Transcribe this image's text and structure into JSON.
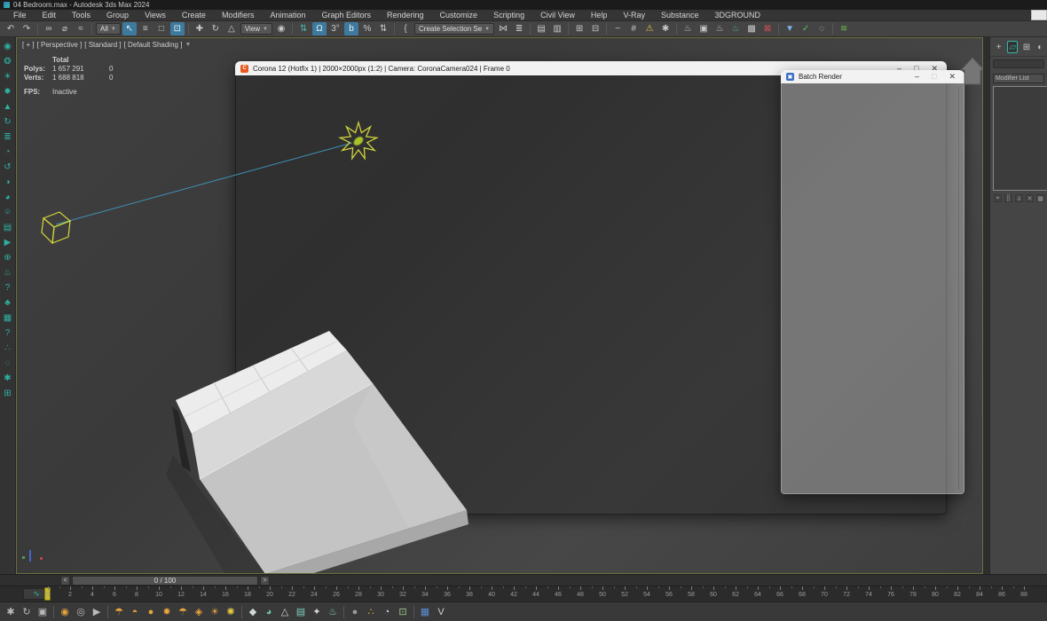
{
  "window": {
    "title": "04 Bedroom.max - Autodesk 3ds Max 2024"
  },
  "menu": {
    "items": [
      "File",
      "Edit",
      "Tools",
      "Group",
      "Views",
      "Create",
      "Modifiers",
      "Animation",
      "Graph Editors",
      "Rendering",
      "Customize",
      "Scripting",
      "Civil View",
      "Help",
      "V-Ray",
      "Substance",
      "3DGROUND"
    ]
  },
  "toolbar": {
    "items": [
      {
        "n": "undo-icon",
        "g": "↶"
      },
      {
        "n": "redo-icon",
        "g": "↷"
      },
      {
        "t": "div"
      },
      {
        "n": "link-icon",
        "g": "∞"
      },
      {
        "n": "unlink-icon",
        "g": "⌀"
      },
      {
        "n": "bind-spacewarp-icon",
        "g": "≈"
      },
      {
        "t": "div"
      },
      {
        "t": "dd",
        "n": "selection-filter-dropdown",
        "l": "All"
      },
      {
        "n": "select-object-icon",
        "g": "↖",
        "a": true
      },
      {
        "n": "select-by-name-icon",
        "g": "≡"
      },
      {
        "n": "selection-region-icon",
        "g": "□"
      },
      {
        "n": "window-crossing-icon",
        "g": "⊡",
        "a": true
      },
      {
        "t": "div"
      },
      {
        "n": "move-icon",
        "g": "✚"
      },
      {
        "n": "rotate-icon",
        "g": "↻"
      },
      {
        "n": "scale-icon",
        "g": "△"
      },
      {
        "t": "dd",
        "n": "reference-coordinate-dropdown",
        "l": "View"
      },
      {
        "n": "use-pivot-icon",
        "g": "◉"
      },
      {
        "t": "div"
      },
      {
        "n": "select-similar-icon",
        "g": "⇅",
        "c": "#49b6a6"
      },
      {
        "n": "snap-toggle-icon",
        "g": "Ω",
        "a": true
      },
      {
        "n": "angle-snap-icon",
        "g": "3°"
      },
      {
        "n": "snap-variant-icon",
        "g": "b",
        "a": true
      },
      {
        "n": "percent-snap-icon",
        "g": "%"
      },
      {
        "n": "spinner-snap-icon",
        "g": "⇅"
      },
      {
        "t": "div"
      },
      {
        "n": "named-selection-sets-icon",
        "g": "{"
      },
      {
        "t": "dd",
        "n": "selection-set-dropdown",
        "l": "Create Selection Se"
      },
      {
        "n": "mirror-icon",
        "g": "⋈"
      },
      {
        "n": "align-icon",
        "g": "≣"
      },
      {
        "t": "div"
      },
      {
        "n": "layer-explorer-icon",
        "g": "▤"
      },
      {
        "n": "toggle-ribbon-icon",
        "g": "▥"
      },
      {
        "t": "div"
      },
      {
        "n": "scene-explorer-icon",
        "g": "⊞"
      },
      {
        "n": "material-explorer-icon",
        "g": "⊟"
      },
      {
        "t": "div"
      },
      {
        "n": "curve-editor-icon",
        "g": "~"
      },
      {
        "n": "schematic-view-icon",
        "g": "#"
      },
      {
        "n": "warning-icon",
        "g": "⚠",
        "c": "#e8c23d"
      },
      {
        "n": "asset-tracking-icon",
        "g": "✱"
      },
      {
        "t": "div"
      },
      {
        "n": "render-setup-icon",
        "g": "♨"
      },
      {
        "n": "rendered-frame-icon",
        "g": "▣"
      },
      {
        "n": "render-production-icon",
        "g": "♨"
      },
      {
        "n": "render-iterative-icon",
        "g": "♨",
        "c": "#49b6a6"
      },
      {
        "n": "render-texture-icon",
        "g": "▩"
      },
      {
        "n": "render-abort-icon",
        "g": "⊠",
        "c": "#d05050"
      },
      {
        "t": "div"
      },
      {
        "n": "save-state-icon",
        "g": "▼",
        "c": "#7fb2e8"
      },
      {
        "n": "check-icon",
        "g": "✓",
        "c": "#5fc060"
      },
      {
        "n": "info-icon",
        "g": "◌"
      },
      {
        "t": "div"
      },
      {
        "n": "corona-toolbar-icon",
        "g": "≋",
        "c": "#6cc04a"
      }
    ]
  },
  "left_toolbar": {
    "items": [
      {
        "n": "camera-icon",
        "g": "◉"
      },
      {
        "n": "camera-settings-icon",
        "g": "❂"
      },
      {
        "n": "light-icon",
        "g": "☀"
      },
      {
        "n": "sun-icon",
        "g": "✹"
      },
      {
        "n": "vegetation-icon",
        "g": "▲"
      },
      {
        "n": "update-icon",
        "g": "↻"
      },
      {
        "n": "list-icon",
        "g": "≣"
      },
      {
        "n": "bell-icon",
        "g": "◔"
      },
      {
        "n": "reset-icon",
        "g": "↺"
      },
      {
        "n": "paint-icon",
        "g": "◑"
      },
      {
        "n": "mask-icon",
        "g": "◕"
      },
      {
        "n": "lamp-icon",
        "g": "⌾"
      },
      {
        "n": "layers-icon",
        "g": "▤"
      },
      {
        "n": "play-icon",
        "g": "▶"
      },
      {
        "n": "target-icon",
        "g": "⊕"
      },
      {
        "n": "teapot-icon",
        "g": "♨"
      },
      {
        "n": "help-icon",
        "g": "?"
      },
      {
        "n": "forest-warning-icon",
        "g": "♣"
      },
      {
        "n": "notes-icon",
        "g": "▦"
      },
      {
        "n": "about-icon",
        "g": "?"
      },
      {
        "n": "scatter-icon",
        "g": "∴"
      },
      {
        "n": "select-circle-icon",
        "g": "◌"
      },
      {
        "n": "particles-icon",
        "g": "✱"
      },
      {
        "n": "grid-array-icon",
        "g": "⊞"
      }
    ]
  },
  "viewport": {
    "label": {
      "plus": "[ + ]",
      "view": "[ Perspective ]",
      "style": "[ Standard ]",
      "shading": "[ Default Shading ]"
    },
    "stats": {
      "total_label": "Total",
      "polys_label": "Polys:",
      "polys_value": "1 657 291",
      "polys_second": "0",
      "verts_label": "Verts:",
      "verts_value": "1 688 818",
      "verts_second": "0",
      "fps_label": "FPS:",
      "fps_value": "Inactive"
    }
  },
  "vfb": {
    "title": "Corona 12 (Hotfix 1) | 2000×2000px (1:2) | Camera: CoronaCamera024 | Frame 0",
    "minimize": "–",
    "maximize": "□",
    "close": "✕"
  },
  "batch": {
    "title": "Batch Render",
    "minimize": "–",
    "maximize": "□",
    "close": "✕"
  },
  "command_panel": {
    "tabs": [
      {
        "n": "create-tab",
        "g": "+"
      },
      {
        "n": "modify-tab",
        "g": "▱",
        "a": true
      },
      {
        "n": "hierarchy-tab",
        "g": "⊞"
      },
      {
        "n": "motion-tab",
        "g": "◐"
      }
    ],
    "modifier_list_label": "Modifier List",
    "stack_buttons": [
      {
        "n": "pin-stack-icon",
        "g": "⌖"
      },
      {
        "n": "show-end-result-icon",
        "g": "║"
      },
      {
        "n": "make-unique-icon",
        "g": "⇓"
      },
      {
        "n": "remove-modifier-icon",
        "g": "✕"
      },
      {
        "n": "configure-modifier-icon",
        "g": "▦"
      }
    ]
  },
  "timeline": {
    "current": "0 / 100",
    "prev": "<",
    "next": ">",
    "labels": [
      0,
      2,
      4,
      6,
      8,
      10,
      12,
      14,
      16,
      18,
      20,
      22,
      24,
      26,
      28,
      30,
      32,
      34,
      36,
      38,
      40,
      42,
      44,
      46,
      48,
      50,
      52,
      54,
      56,
      58,
      60,
      62,
      64,
      66,
      68,
      70,
      72,
      74,
      76,
      78,
      80,
      82,
      84,
      86,
      88
    ],
    "frames_end": 88
  },
  "bottom_toolbar": {
    "items": [
      {
        "n": "pan-hand-icon",
        "g": "✱",
        "c": "#b9b9b9"
      },
      {
        "n": "orbit-icon",
        "g": "↻",
        "c": "#b9b9b9"
      },
      {
        "n": "camera-frame-icon",
        "g": "▣",
        "c": "#b9b9b9"
      },
      {
        "t": "div"
      },
      {
        "n": "light-bulb-icon",
        "g": "◉",
        "c": "#e8a33d"
      },
      {
        "n": "camera-icon",
        "g": "◎",
        "c": "#b9b9b9"
      },
      {
        "n": "video-camera-icon",
        "g": "▶",
        "c": "#b9b9b9"
      },
      {
        "t": "div"
      },
      {
        "n": "corona-light-icon",
        "g": "☂",
        "c": "#e8a33d"
      },
      {
        "n": "dome-light-icon",
        "g": "◓",
        "c": "#e8a33d"
      },
      {
        "n": "sphere-light-icon",
        "g": "●",
        "c": "#e8a33d"
      },
      {
        "n": "gear-icon",
        "g": "✸",
        "c": "#e8a33d"
      },
      {
        "n": "sky-light-icon",
        "g": "☂",
        "c": "#e8a33d"
      },
      {
        "n": "caustics-icon",
        "g": "◈",
        "c": "#e8a33d"
      },
      {
        "n": "sun-light-icon",
        "g": "☀",
        "c": "#e8a33d"
      },
      {
        "n": "sunburst-icon",
        "g": "✺",
        "c": "#e5c93f"
      },
      {
        "t": "div"
      },
      {
        "n": "polyhedron-icon",
        "g": "◆",
        "c": "#cfd8d8"
      },
      {
        "n": "scatter-sphere-icon",
        "g": "◕",
        "c": "#69c0a8"
      },
      {
        "n": "proxy-pyramid-icon",
        "g": "△",
        "c": "#cfd8d8"
      },
      {
        "n": "slicer-icon",
        "g": "▤",
        "c": "#7fd0c0"
      },
      {
        "n": "interactive-hand-icon",
        "g": "✦",
        "c": "#cfd8d8"
      },
      {
        "n": "fire-icon",
        "g": "♨",
        "c": "#7fd0c0"
      },
      {
        "t": "div"
      },
      {
        "n": "material-sphere-icon",
        "g": "●",
        "c": "#9a9a9a"
      },
      {
        "n": "particle-dots-icon",
        "g": "∴",
        "c": "#e8a33d"
      },
      {
        "n": "mask-icon",
        "g": "◔",
        "c": "#cfcfcf"
      },
      {
        "n": "display-icon",
        "g": "⊡",
        "c": "#9fd08f"
      },
      {
        "t": "div"
      },
      {
        "n": "swatches-icon",
        "g": "▦",
        "c": "#5b8fd4"
      },
      {
        "n": "vray-logo-icon",
        "g": "V",
        "c": "#cfcfcf"
      }
    ]
  },
  "colors": {
    "accent_teal": "#2fb0a0",
    "highlight_blue": "#3d7a9e",
    "gizmo_yellow": "#d8d83a",
    "corona_orange": "#e8591d",
    "viewport_border": "#6e6e3c"
  }
}
